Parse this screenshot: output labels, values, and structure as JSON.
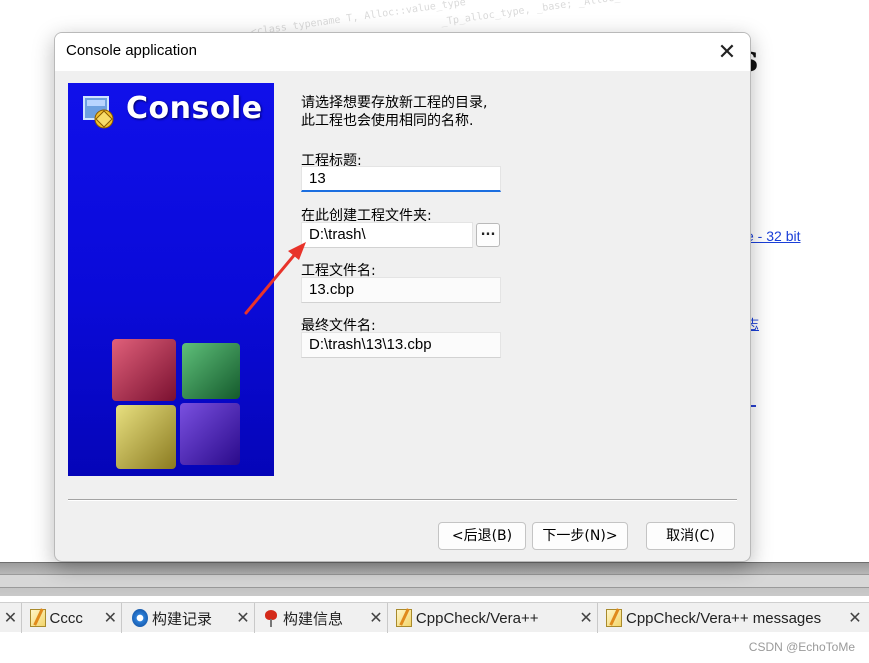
{
  "background": {
    "link_text": "e - 32 bit",
    "big_letter": "s",
    "small_link": "志"
  },
  "dialog": {
    "title": "Console application",
    "close_glyph": "✕",
    "banner": {
      "title": "Console",
      "background_color": "#0a0ad8"
    },
    "intro": {
      "line1": "请选择想要存放新工程的目录,",
      "line2": "此工程也会使用相同的名称."
    },
    "fields": {
      "project_title": {
        "label": "工程标题:",
        "value": "13"
      },
      "folder": {
        "label": "在此创建工程文件夹:",
        "value": "D:\\trash\\",
        "browse_label": "..."
      },
      "project_file": {
        "label": "工程文件名:",
        "value": "13.cbp"
      },
      "result_file": {
        "label": "最终文件名:",
        "value": "D:\\trash\\13\\13.cbp"
      }
    },
    "buttons": {
      "back": "<后退(B)",
      "next": "下一步(N)>",
      "cancel": "取消(C)"
    },
    "annotation_arrow_color": "#e8332a"
  },
  "taskbar": {
    "tabs": [
      {
        "label": "Cccc",
        "icon": "note-icon"
      },
      {
        "label": "构建记录",
        "icon": "gear-icon"
      },
      {
        "label": "构建信息",
        "icon": "pin-icon"
      },
      {
        "label": "CppCheck/Vera++",
        "icon": "note-icon"
      },
      {
        "label": "CppCheck/Vera++ messages",
        "icon": "note-icon"
      }
    ],
    "close_glyph": "✕"
  },
  "watermark": "CSDN @EchoToMe"
}
